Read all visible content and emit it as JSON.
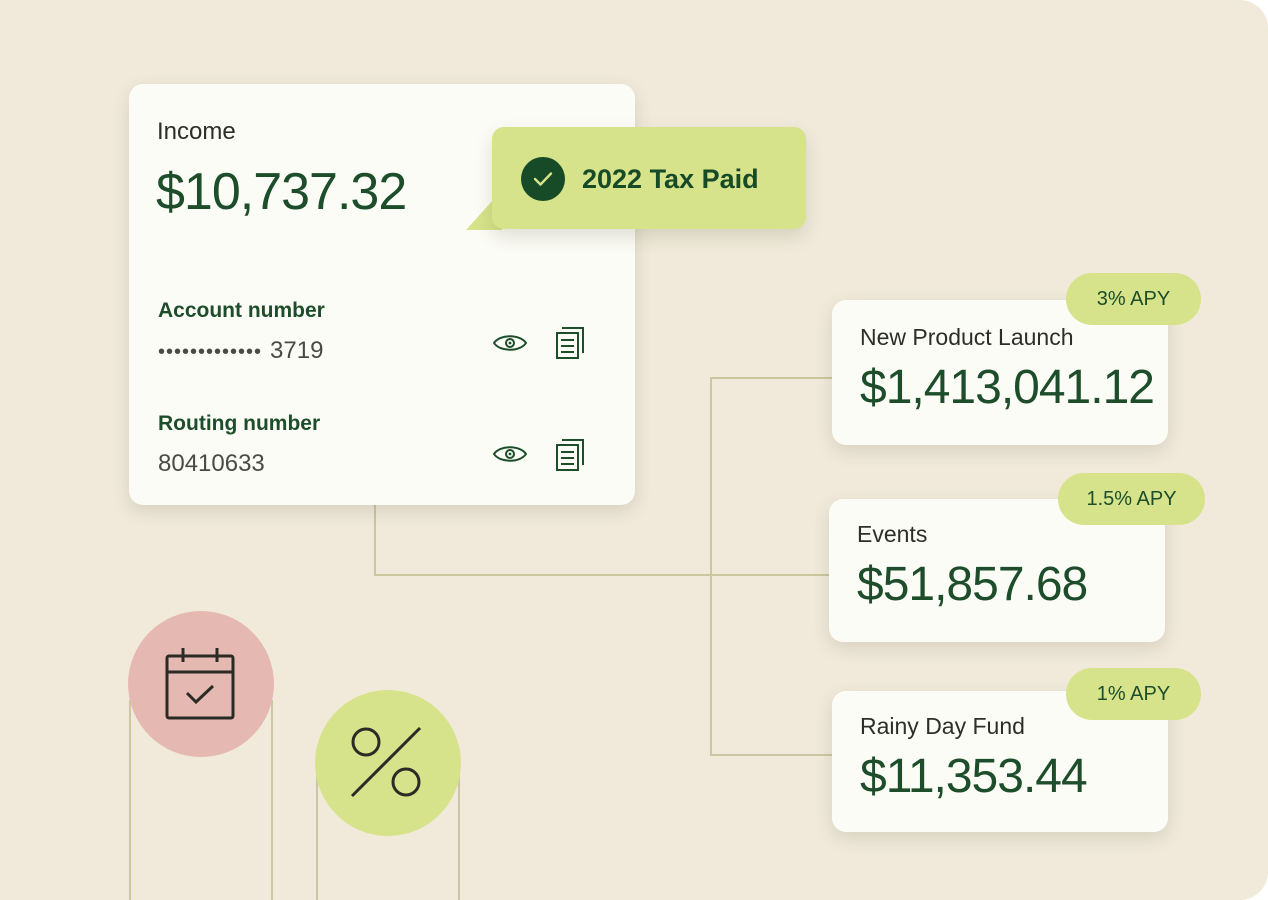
{
  "income_card": {
    "label": "Income",
    "amount": "$10,737.32",
    "account_number": {
      "label": "Account number",
      "masked": "•••••••••••••",
      "last4": "3719"
    },
    "routing_number": {
      "label": "Routing number",
      "value": "80410633"
    }
  },
  "tax_badge": {
    "text": "2022 Tax Paid"
  },
  "accounts": [
    {
      "name": "New Product Launch",
      "amount": "$1,413,041.12",
      "apy": "3% APY"
    },
    {
      "name": "Events",
      "amount": "$51,857.68",
      "apy": "1.5% APY"
    },
    {
      "name": "Rainy Day Fund",
      "amount": "$11,353.44",
      "apy": "1% APY"
    }
  ],
  "decor_icons": [
    "calendar-check-icon",
    "percent-icon"
  ],
  "colors": {
    "background": "#f1eadb",
    "card": "#fcfcf6",
    "brand_green": "#1d4d2a",
    "accent_lime": "#d6e38a",
    "accent_pink": "#e6b8b2"
  }
}
